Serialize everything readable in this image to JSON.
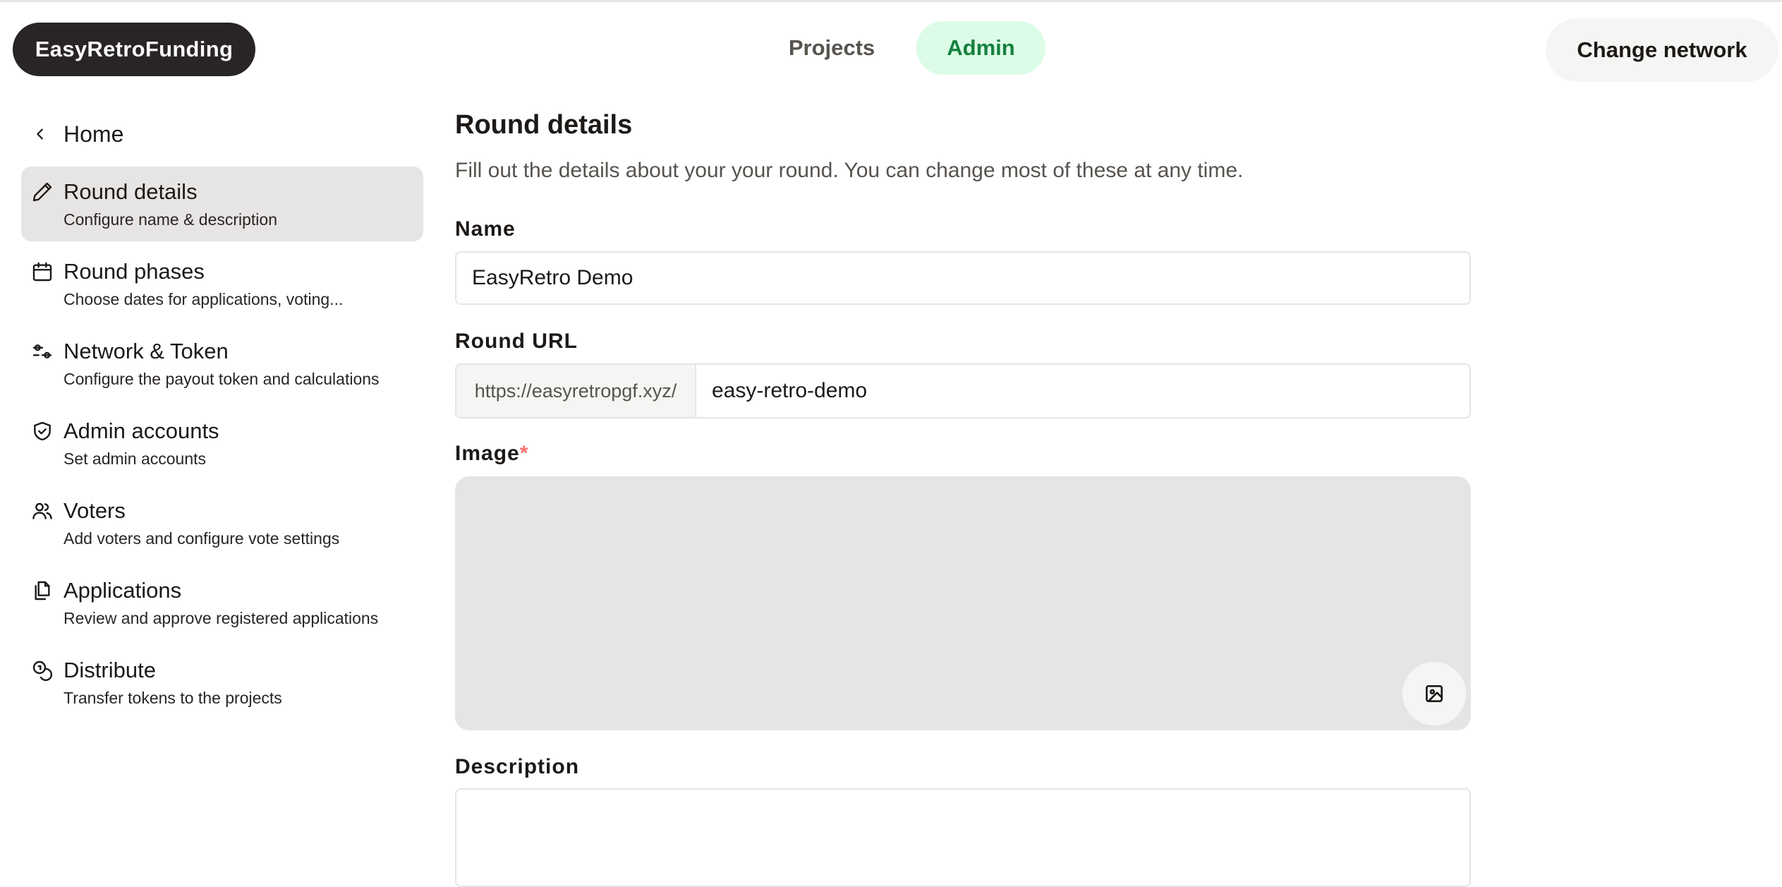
{
  "header": {
    "brand": "EasyRetroFunding",
    "nav": [
      {
        "label": "Projects",
        "active": false
      },
      {
        "label": "Admin",
        "active": true
      }
    ],
    "change_network_label": "Change network"
  },
  "sidebar": {
    "home_label": "Home",
    "items": [
      {
        "icon": "pencil-icon",
        "title": "Round details",
        "subtitle": "Configure name & description",
        "active": true
      },
      {
        "icon": "calendar-icon",
        "title": "Round phases",
        "subtitle": "Choose dates for applications, voting...",
        "active": false
      },
      {
        "icon": "sliders-icon",
        "title": "Network & Token",
        "subtitle": "Configure the payout token and calculations",
        "active": false
      },
      {
        "icon": "shield-check-icon",
        "title": "Admin accounts",
        "subtitle": "Set admin accounts",
        "active": false
      },
      {
        "icon": "users-icon",
        "title": "Voters",
        "subtitle": "Add voters and configure vote settings",
        "active": false
      },
      {
        "icon": "files-icon",
        "title": "Applications",
        "subtitle": "Review and approve registered applications",
        "active": false
      },
      {
        "icon": "coins-icon",
        "title": "Distribute",
        "subtitle": "Transfer tokens to the projects",
        "active": false
      }
    ]
  },
  "main": {
    "title": "Round details",
    "description": "Fill out the details about your your round. You can change most of these at any time.",
    "name": {
      "label": "Name",
      "value": "EasyRetro Demo"
    },
    "round_url": {
      "label": "Round URL",
      "prefix": "https://easyretropgf.xyz/",
      "value": "easy-retro-demo"
    },
    "image": {
      "label": "Image",
      "required_mark": "*"
    },
    "description_field": {
      "label": "Description",
      "value": ""
    }
  },
  "colors": {
    "brand_bg": "#292524",
    "admin_active_bg": "#dcfce7",
    "admin_active_text": "#15803d",
    "sidebar_active_bg": "#e7e5e4",
    "required": "#f87171"
  }
}
